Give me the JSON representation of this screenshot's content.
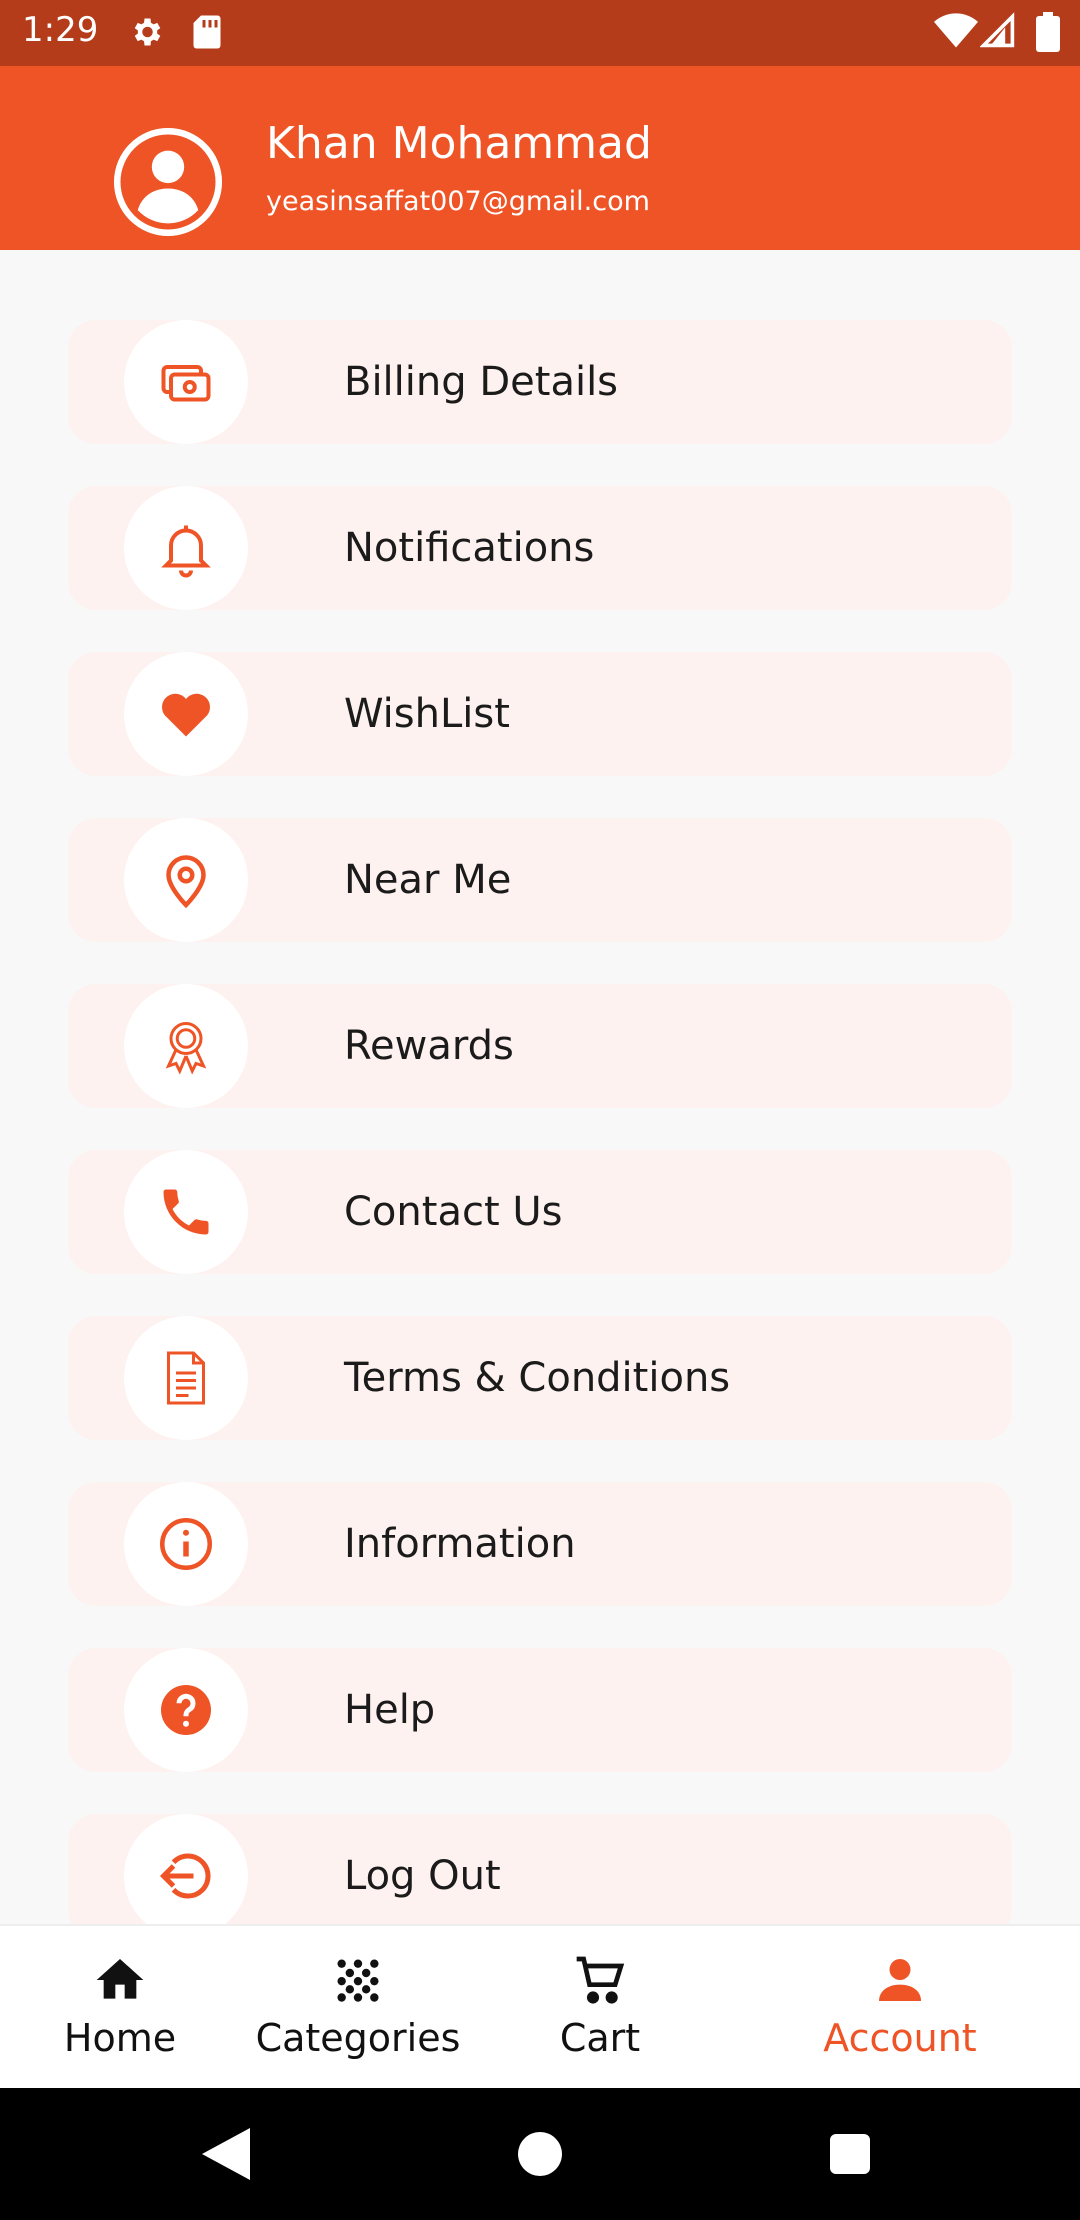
{
  "status_bar": {
    "time": "1:29",
    "icons": [
      "gear-icon",
      "sd-card-icon",
      "wifi-icon",
      "signal-icon",
      "battery-icon"
    ]
  },
  "profile": {
    "name": "Khan Mohammad",
    "email": "yeasinsaffat007@gmail.com",
    "avatar_icon": "user-avatar-icon"
  },
  "menu": {
    "items": [
      {
        "label": "Billing Details",
        "icon": "money-icon"
      },
      {
        "label": "Notifications",
        "icon": "bell-icon"
      },
      {
        "label": "WishList",
        "icon": "heart-icon"
      },
      {
        "label": "Near Me",
        "icon": "location-pin-icon"
      },
      {
        "label": "Rewards",
        "icon": "award-ribbon-icon"
      },
      {
        "label": "Contact Us",
        "icon": "phone-icon"
      },
      {
        "label": "Terms & Conditions",
        "icon": "document-icon"
      },
      {
        "label": "Information",
        "icon": "info-icon"
      },
      {
        "label": "Help",
        "icon": "question-icon"
      },
      {
        "label": "Log Out",
        "icon": "logout-icon"
      }
    ]
  },
  "bottom_nav": {
    "items": [
      {
        "label": "Home",
        "icon": "home-icon"
      },
      {
        "label": "Categories",
        "icon": "categories-icon"
      },
      {
        "label": "Cart",
        "icon": "cart-icon"
      },
      {
        "label": "Account",
        "icon": "account-icon",
        "active": true
      }
    ]
  },
  "colors": {
    "accent": "#ef5426",
    "status_bar": "#b53c1a",
    "menu_item_bg": "#fdf2ef",
    "page_bg": "#f8f8f8"
  }
}
